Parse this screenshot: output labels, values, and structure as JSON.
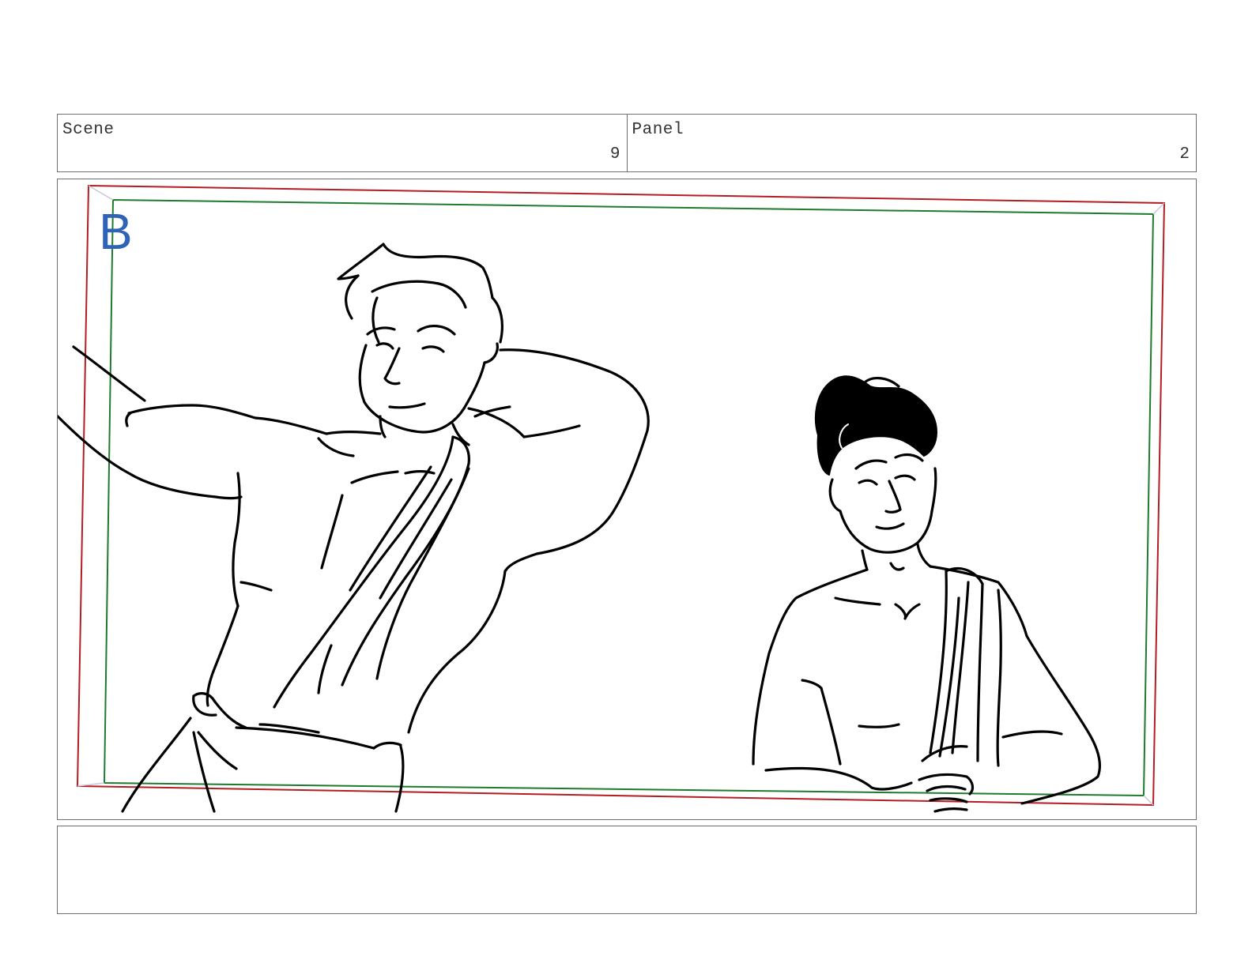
{
  "header": {
    "scene_label": "Scene",
    "scene_number": "9",
    "panel_label": "Panel",
    "panel_number": "2"
  },
  "panel": {
    "camera_label": "B",
    "colors": {
      "action_safe": "#b11d22",
      "title_safe": "#1e7a2c",
      "camera_label": "#2f63b8",
      "line_art": "#000000"
    }
  },
  "notes": {
    "text": ""
  }
}
